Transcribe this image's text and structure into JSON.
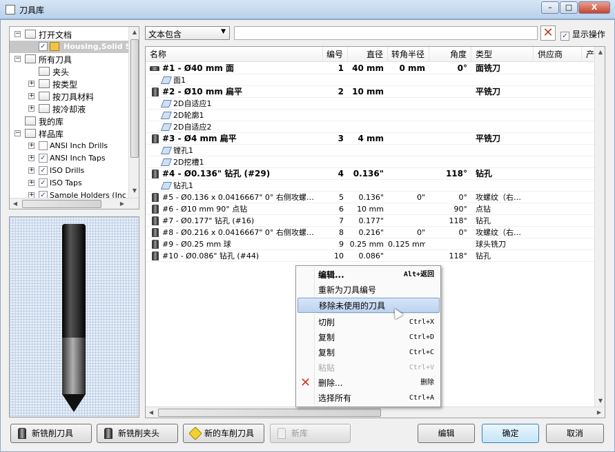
{
  "window": {
    "title": "刀具库",
    "controls": {
      "minimize": "–",
      "maximize": "□",
      "close": "X"
    }
  },
  "tree": {
    "items": [
      {
        "label": "打开文档",
        "level": 0,
        "expander": "−",
        "icon": "open-folder-icon"
      },
      {
        "label": "Housing,Solid Sta",
        "level": 1,
        "checked": true,
        "selected": true,
        "icon": "part-icon"
      },
      {
        "label": "所有刀具",
        "level": 0,
        "expander": "−",
        "icon": "library-icon"
      },
      {
        "label": "夹头",
        "level": 1,
        "icon": "library-icon"
      },
      {
        "label": "按类型",
        "level": 1,
        "expander": "+",
        "icon": "library-icon"
      },
      {
        "label": "按刀具材料",
        "level": 1,
        "expander": "+",
        "icon": "library-icon"
      },
      {
        "label": "按冷却液",
        "level": 1,
        "expander": "+",
        "icon": "library-icon"
      },
      {
        "label": "我的库",
        "level": 0,
        "icon": "folder-icon"
      },
      {
        "label": "样品库",
        "level": 0,
        "expander": "−",
        "icon": "folder-icon"
      },
      {
        "label": "ANSI Inch Drills",
        "level": 1,
        "expander": "+",
        "checked": false
      },
      {
        "label": "ANSI Inch Taps",
        "level": 1,
        "expander": "+",
        "checked": true
      },
      {
        "label": "ISO Drills",
        "level": 1,
        "expander": "+",
        "checked": true
      },
      {
        "label": "ISO Taps",
        "level": 1,
        "expander": "+",
        "checked": true
      },
      {
        "label": "Sample Holders (Inc",
        "level": 1,
        "expander": "+",
        "checked": true
      }
    ]
  },
  "filter": {
    "mode": "文本包含",
    "search_value": "",
    "show_operations_label": "显示操作",
    "show_operations": true
  },
  "table": {
    "columns": [
      "名称",
      "编号",
      "直径",
      "转角半径",
      "角度",
      "类型",
      "供应商",
      "产品"
    ],
    "rows": [
      {
        "kind": "tool",
        "name": "#1 - Ø40 mm 面",
        "number": "1",
        "diameter": "40 mm",
        "corner": "0 mm",
        "angle": "0°",
        "type": "面铣刀",
        "icon": "face-mill-icon"
      },
      {
        "kind": "op",
        "name": "面1",
        "icon": "face-op-icon"
      },
      {
        "kind": "tool",
        "name": "#2 - Ø10 mm 扁平",
        "number": "2",
        "diameter": "10 mm",
        "corner": "",
        "angle": "",
        "type": "平铣刀",
        "icon": "flat-mill-icon"
      },
      {
        "kind": "op",
        "name": "2D自适应1",
        "icon": "adaptive-op-icon"
      },
      {
        "kind": "op",
        "name": "2D轮廓1",
        "icon": "contour-op-icon"
      },
      {
        "kind": "op",
        "name": "2D自适应2",
        "icon": "adaptive-op-icon"
      },
      {
        "kind": "tool",
        "name": "#3 - Ø4 mm 扁平",
        "number": "3",
        "diameter": "4 mm",
        "corner": "",
        "angle": "",
        "type": "平铣刀",
        "icon": "flat-mill-icon"
      },
      {
        "kind": "op",
        "name": "镗孔1",
        "icon": "bore-op-icon"
      },
      {
        "kind": "op",
        "name": "2D挖槽1",
        "icon": "pocket-op-icon"
      },
      {
        "kind": "tool",
        "name": "#4 - Ø0.136\" 钻孔 (#29)",
        "number": "4",
        "diameter": "0.136\"",
        "corner": "",
        "angle": "118°",
        "type": "钻孔",
        "icon": "drill-icon"
      },
      {
        "kind": "op",
        "name": "钻孔1",
        "icon": "drill-op-icon"
      },
      {
        "kind": "plain",
        "name": "#5 - Ø0.136 x 0.0416667\" 0° 右侧攻螺…",
        "number": "5",
        "diameter": "0.136\"",
        "corner": "0\"",
        "angle": "0°",
        "type": "攻螺纹（右…",
        "icon": "tap-icon"
      },
      {
        "kind": "plain",
        "name": "#6 - Ø10 mm 90° 点钻",
        "number": "6",
        "diameter": "10 mm",
        "corner": "",
        "angle": "90°",
        "type": "点钻",
        "icon": "spot-drill-icon"
      },
      {
        "kind": "plain",
        "name": "#7 - Ø0.177\" 钻孔 (#16)",
        "number": "7",
        "diameter": "0.177\"",
        "corner": "",
        "angle": "118°",
        "type": "钻孔",
        "icon": "drill-icon"
      },
      {
        "kind": "plain",
        "name": "#8 - Ø0.216 x 0.0416667\" 0° 右侧攻螺…",
        "number": "8",
        "diameter": "0.216\"",
        "corner": "0\"",
        "angle": "0°",
        "type": "攻螺纹（右…",
        "icon": "tap-icon"
      },
      {
        "kind": "plain",
        "name": "#9 - Ø0.25 mm 球",
        "number": "9",
        "diameter": "0.25 mm",
        "corner": "0.125 mm",
        "angle": "",
        "type": "球头铣刀",
        "icon": "ball-mill-icon"
      },
      {
        "kind": "plain",
        "name": "#10 - Ø0.086\" 钻孔 (#44)",
        "number": "10",
        "diameter": "0.086\"",
        "corner": "",
        "angle": "118°",
        "type": "钻孔",
        "icon": "drill-icon"
      }
    ]
  },
  "context_menu": {
    "items": [
      {
        "label": "编辑...",
        "shortcut": "Alt+返回",
        "bold": true
      },
      {
        "label": "重新为刀具编号",
        "shortcut": ""
      },
      {
        "label": "移除未使用的刀具",
        "shortcut": "",
        "highlighted": true
      },
      {
        "label": "切削",
        "shortcut": "Ctrl+X"
      },
      {
        "label": "复制",
        "shortcut": "Ctrl+D"
      },
      {
        "label": "复制",
        "shortcut": "Ctrl+C"
      },
      {
        "label": "粘贴",
        "shortcut": "Ctrl+V",
        "disabled": true
      },
      {
        "label": "删除...",
        "shortcut": "删除",
        "icon": "delete-x-icon"
      },
      {
        "label": "选择所有",
        "shortcut": "Ctrl+A"
      }
    ]
  },
  "buttons": {
    "new_mill_tool": "新铣削刀具",
    "new_mill_holder": "新铣削夹头",
    "new_turn_tool": "新的车削刀具",
    "new_library": "新库",
    "edit": "编辑",
    "ok": "确定",
    "cancel": "取消"
  },
  "colors": {
    "accent": "#3c7fb1",
    "menu_highlight": "#bdd3ef",
    "delete_red": "#d2391a"
  }
}
